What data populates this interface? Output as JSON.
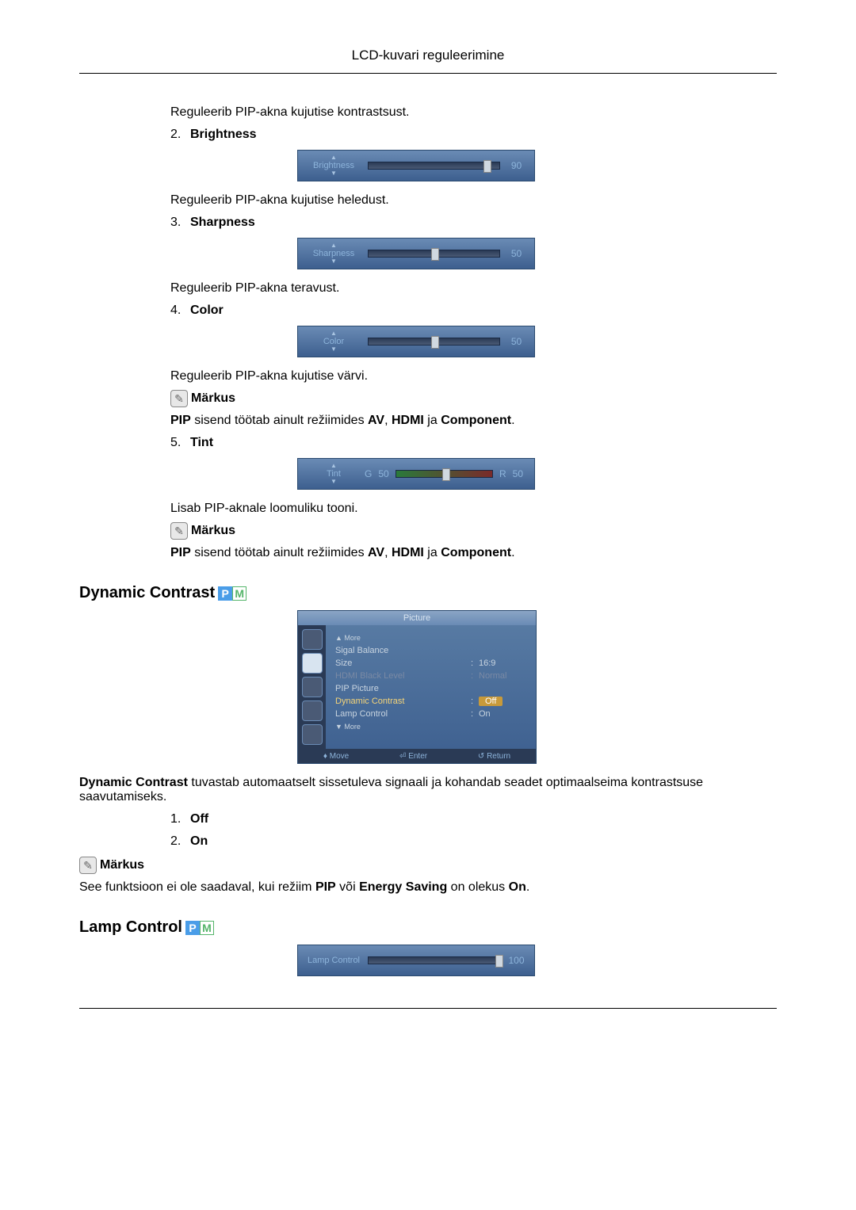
{
  "header": "LCD-kuvari reguleerimine",
  "intro": "Reguleerib PIP-akna kujutise kontrastsust.",
  "items": {
    "brightness": {
      "num": "2.",
      "label": "Brightness",
      "slider_name": "Brightness",
      "value": "90",
      "desc": "Reguleerib PIP-akna kujutise heledust."
    },
    "sharpness": {
      "num": "3.",
      "label": "Sharpness",
      "slider_name": "Sharpness",
      "value": "50",
      "desc": "Reguleerib PIP-akna teravust."
    },
    "color": {
      "num": "4.",
      "label": "Color",
      "slider_name": "Color",
      "value": "50",
      "desc": "Reguleerib PIP-akna kujutise värvi.",
      "note_label": "Märkus",
      "note_pre": "PIP",
      "note_mid": " sisend töötab ainult režiimides ",
      "note_av": "AV",
      "note_hdmi": "HDMI",
      "note_comp": "Component",
      "note_ja": " ja ",
      "note_sep": ", "
    },
    "tint": {
      "num": "5.",
      "label": "Tint",
      "slider_name": "Tint",
      "g_label": "G",
      "g_val": "50",
      "r_label": "R",
      "r_val": "50",
      "desc": "Lisab PIP-aknale loomuliku tooni.",
      "note_label": "Märkus",
      "note_pre": "PIP",
      "note_mid": " sisend töötab ainult režiimides ",
      "note_av": "AV",
      "note_hdmi": "HDMI",
      "note_comp": "Component",
      "note_ja": " ja ",
      "note_sep": ", "
    }
  },
  "dynamic_contrast": {
    "heading": "Dynamic Contrast",
    "osd_title": "Picture",
    "menu": {
      "more_up": "▲ More",
      "signal_balance": "Sigal Balance",
      "size_label": "Size",
      "size_val": "16:9",
      "hdmi_label": "HDMI Black Level",
      "hdmi_val": "Normal",
      "pip_picture": "PIP Picture",
      "dc_label": "Dynamic Contrast",
      "dc_val": "Off",
      "lamp_label": "Lamp Control",
      "lamp_val": "On",
      "more_down": "▼ More"
    },
    "footer": {
      "move": "Move",
      "enter": "Enter",
      "return": "Return"
    },
    "desc_pre": "Dynamic Contrast",
    "desc_rest": " tuvastab automaatselt sissetuleva signaali ja kohandab seadet optimaalseima kontrastsuse saavutamiseks.",
    "off_num": "1.",
    "off_label": "Off",
    "on_num": "2.",
    "on_label": "On",
    "note_label": "Märkus",
    "note_a": "See funktsioon ei ole saadaval, kui režiim ",
    "note_pip": "PIP",
    "note_b": " või ",
    "note_es": "Energy Saving",
    "note_c": " on olekus ",
    "note_on": "On",
    "note_d": "."
  },
  "lamp_control": {
    "heading": "Lamp Control",
    "slider_name": "Lamp Control",
    "value": "100"
  }
}
